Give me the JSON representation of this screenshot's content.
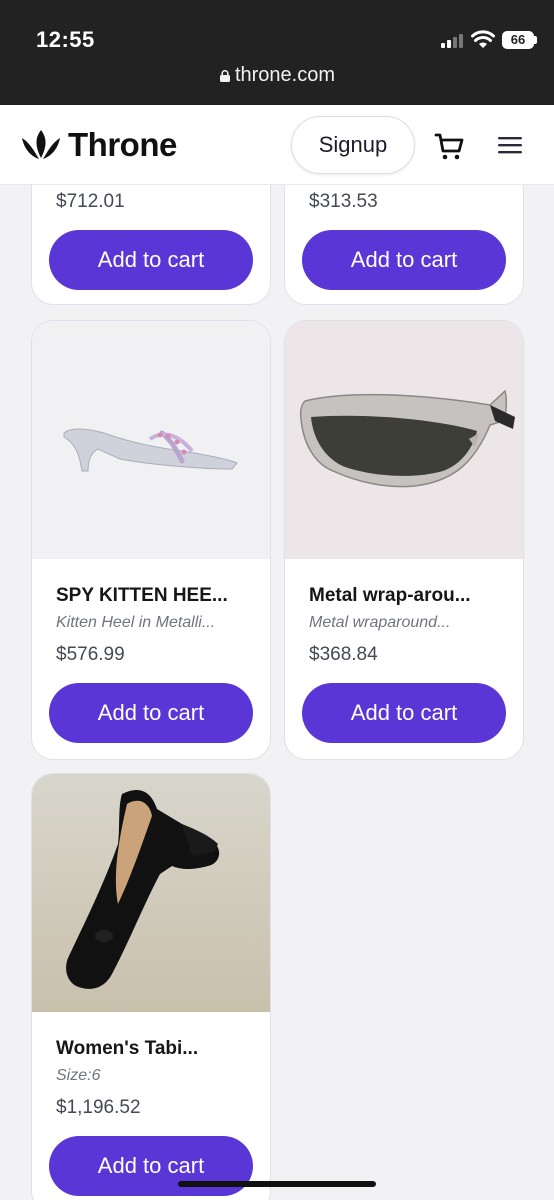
{
  "status_bar": {
    "time": "12:55",
    "battery": "66"
  },
  "browser": {
    "url": "throne.com"
  },
  "header": {
    "brand": "Throne",
    "signup_label": "Signup"
  },
  "products": [
    {
      "price": "$712.01",
      "cta": "Add to cart"
    },
    {
      "price": "$313.53",
      "cta": "Add to cart"
    },
    {
      "title": "SPY KITTEN HEE...",
      "subtitle": "Kitten Heel in Metalli...",
      "price": "$576.99",
      "cta": "Add to cart"
    },
    {
      "title": "Metal wrap-arou...",
      "subtitle": "Metal wraparound...",
      "price": "$368.84",
      "cta": "Add to cart"
    },
    {
      "title": "Women's Tabi...",
      "subtitle": "Size:6",
      "price": "$1,196.52",
      "cta": "Add to cart"
    }
  ],
  "colors": {
    "accent": "#5a36d6",
    "status_bar": "#222222",
    "card_border": "#dde1ea"
  },
  "icons": [
    "lock-icon",
    "crown-logo-icon",
    "cart-icon",
    "hamburger-menu-icon",
    "signal-icon",
    "wifi-icon",
    "battery-icon"
  ]
}
